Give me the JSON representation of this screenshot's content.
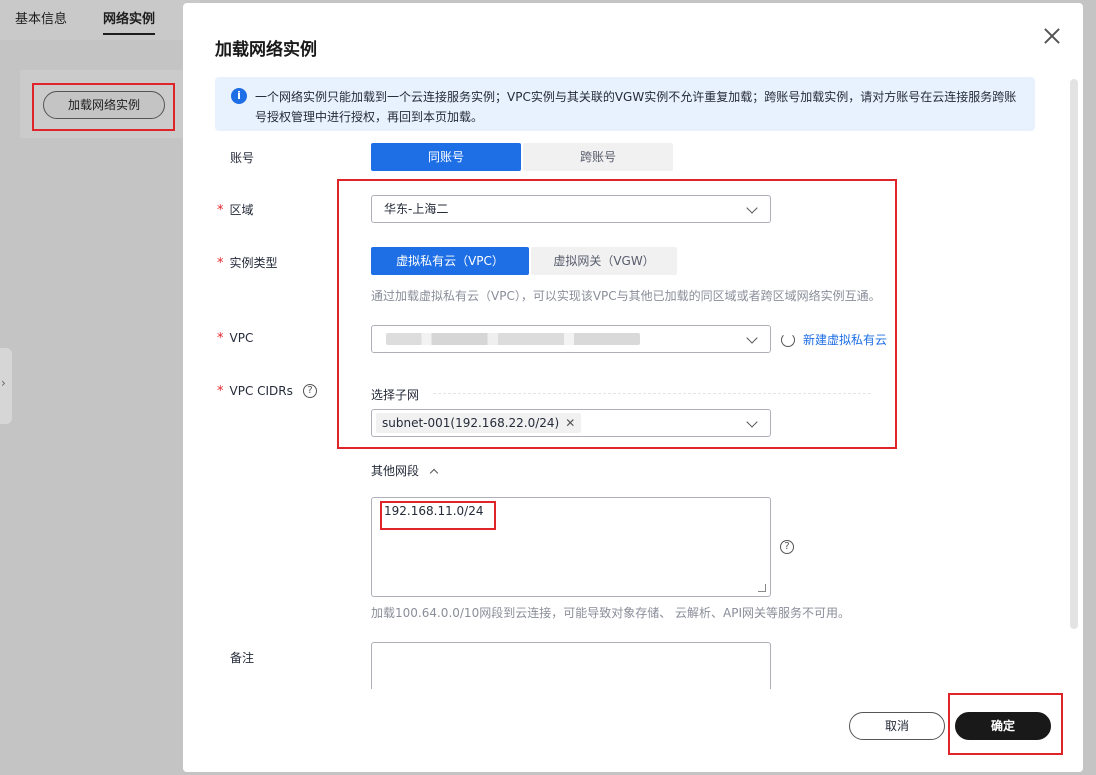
{
  "background": {
    "tabs": [
      "基本信息",
      "网络实例"
    ],
    "add_button": "加载网络实例"
  },
  "modal": {
    "title": "加载网络实例",
    "info": "一个网络实例只能加载到一个云连接服务实例；VPC实例与其关联的VGW实例不允许重复加载；跨账号加载实例，请对方账号在云连接服务跨账号授权管理中进行授权，再回到本页加载。",
    "account": {
      "label": "账号",
      "options": [
        "同账号",
        "跨账号"
      ],
      "selected": "同账号"
    },
    "region": {
      "label": "区域",
      "value": "华东-上海二"
    },
    "instance_type": {
      "label": "实例类型",
      "options": [
        "虚拟私有云（VPC）",
        "虚拟网关（VGW）"
      ],
      "selected": "虚拟私有云（VPC）",
      "hint": "通过加载虚拟私有云（VPC），可以实现该VPC与其他已加载的同区域或者跨区域网络实例互通。"
    },
    "vpc": {
      "label": "VPC",
      "create_link": "新建虚拟私有云"
    },
    "vpc_cidrs": {
      "label": "VPC CIDRs",
      "subnet_label": "选择子网",
      "subnet_tag": "subnet-001(192.168.22.0/24)"
    },
    "other_segments": {
      "label": "其他网段",
      "value": "192.168.11.0/24",
      "hint": "加载100.64.0.0/10网段到云连接，可能导致对象存储、 云解析、API网关等服务不可用。"
    },
    "remark": {
      "label": "备注"
    },
    "buttons": {
      "cancel": "取消",
      "confirm": "确定"
    }
  },
  "colors": {
    "primary": "#1e6fe6",
    "highlight_box": "#e0252a",
    "confirm_bg": "#191919"
  }
}
